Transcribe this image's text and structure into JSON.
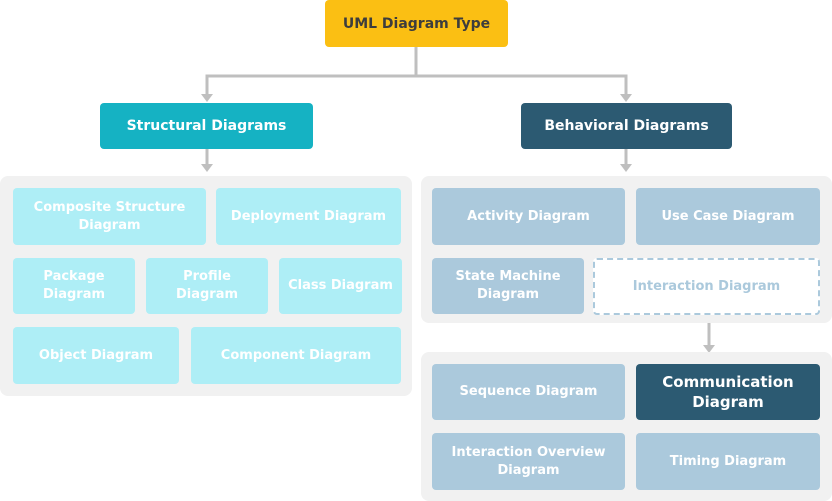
{
  "root": {
    "label": "UML Diagram Type"
  },
  "structural": {
    "label": "Structural Diagrams",
    "items": [
      "Composite Structure Diagram",
      "Deployment Diagram",
      "Package Diagram",
      "Profile Diagram",
      "Class Diagram",
      "Object Diagram",
      "Component Diagram"
    ]
  },
  "behavioral": {
    "label": "Behavioral Diagrams",
    "items": [
      "Activity Diagram",
      "Use Case Diagram",
      "State Machine Diagram",
      "Interaction Diagram"
    ]
  },
  "interaction": {
    "items": [
      "Sequence Diagram",
      "Communication Diagram",
      "Interaction Overview Diagram",
      "Timing Diagram"
    ]
  },
  "colors": {
    "root": "#fbbf13",
    "structural": "#15b2c3",
    "behavioral": "#2c5a72",
    "structural_item": "#aeeef6",
    "behavioral_item": "#abc9dc",
    "connector": "#bfbfbf",
    "panel": "#f1f1f1"
  }
}
